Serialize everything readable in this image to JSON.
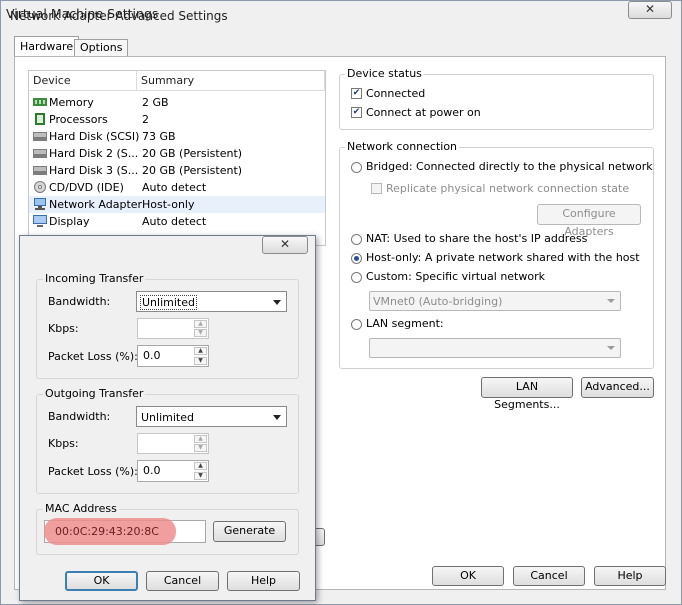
{
  "main_window": {
    "title": "Virtual Machine Settings",
    "tabs": [
      {
        "label": "Hardware",
        "active": true
      },
      {
        "label": "Options",
        "active": false
      }
    ]
  },
  "device_list": {
    "headers": [
      "Device",
      "Summary"
    ],
    "rows": [
      {
        "device": "Memory",
        "summary": "2 GB",
        "icon": "memory-icon"
      },
      {
        "device": "Processors",
        "summary": "2",
        "icon": "processor-icon"
      },
      {
        "device": "Hard Disk (SCSI)",
        "summary": "73 GB",
        "icon": "hard-disk-icon"
      },
      {
        "device": "Hard Disk 2 (S...",
        "summary": "20 GB (Persistent)",
        "icon": "hard-disk-icon"
      },
      {
        "device": "Hard Disk 3 (S...",
        "summary": "20 GB (Persistent)",
        "icon": "hard-disk-icon"
      },
      {
        "device": "CD/DVD (IDE)",
        "summary": "Auto detect",
        "icon": "cd-dvd-icon"
      },
      {
        "device": "Network Adapter",
        "summary": "Host-only",
        "icon": "network-adapter-icon",
        "selected": true
      },
      {
        "device": "Display",
        "summary": "Auto detect",
        "icon": "display-icon"
      }
    ]
  },
  "device_status": {
    "title": "Device status",
    "connected": {
      "label": "Connected",
      "checked": true
    },
    "connect_at_power_on": {
      "label": "Connect at power on",
      "checked": true
    }
  },
  "network_connection": {
    "title": "Network connection",
    "bridged": {
      "label": "Bridged: Connected directly to the physical network",
      "selected": false
    },
    "replicate": {
      "label": "Replicate physical network connection state",
      "checked": false,
      "disabled": true
    },
    "configure_adapters_label": "Configure Adapters",
    "nat": {
      "label": "NAT: Used to share the host's IP address",
      "selected": false
    },
    "host_only": {
      "label": "Host-only: A private network shared with the host",
      "selected": true
    },
    "custom": {
      "label": "Custom: Specific virtual network",
      "selected": false
    },
    "custom_value": "VMnet0 (Auto-bridging)",
    "lan_segment": {
      "label": "LAN segment:",
      "selected": false
    },
    "lan_segment_value": ""
  },
  "lan_segments_label": "LAN Segments...",
  "advanced_label": "Advanced...",
  "main_footer": {
    "ok": "OK",
    "cancel": "Cancel",
    "help": "Help"
  },
  "dialog": {
    "title": "Network Adapter Advanced Settings",
    "incoming": {
      "title": "Incoming Transfer",
      "bandwidth_label": "Bandwidth:",
      "bandwidth_value": "Unlimited",
      "kbps_label": "Kbps:",
      "kbps_value": "",
      "packet_loss_label": "Packet Loss (%):",
      "packet_loss_value": "0.0"
    },
    "outgoing": {
      "title": "Outgoing Transfer",
      "bandwidth_label": "Bandwidth:",
      "bandwidth_value": "Unlimited",
      "kbps_label": "Kbps:",
      "kbps_value": "",
      "packet_loss_label": "Packet Loss (%):",
      "packet_loss_value": "0.0"
    },
    "mac": {
      "title": "MAC Address",
      "value": "00:0C:29:43:20:8C",
      "generate_label": "Generate"
    },
    "ok": "OK",
    "cancel": "Cancel",
    "help": "Help"
  },
  "colors": {
    "highlight": "#ef8d8d",
    "selection": "#e8f0fb",
    "focus_border": "#3c7fb1"
  }
}
